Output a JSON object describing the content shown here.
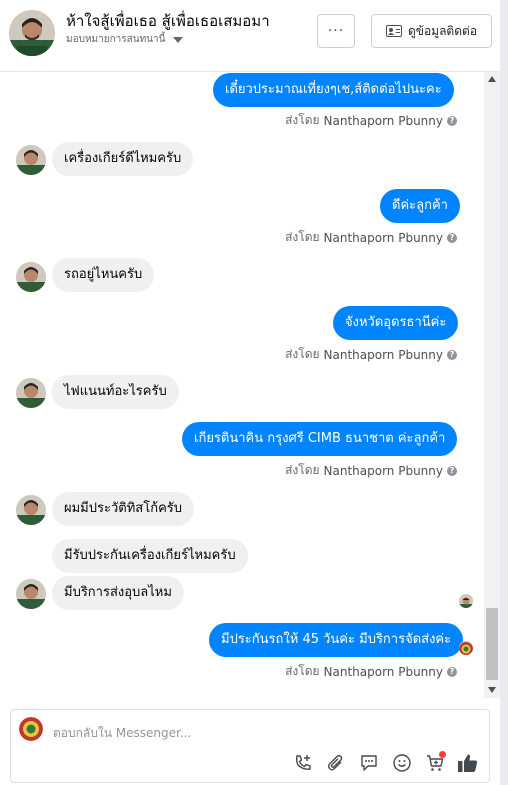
{
  "header": {
    "title": "ห้าใจสู้เพื่อเธอ สู้เพื่อเธอเสมอมา",
    "subtitle": "มอบหมายการสนทนานี้",
    "more_label": "···",
    "contact_label": "ดูข้อมูลติดต่อ"
  },
  "messages": {
    "m1": "เดี๋ยวประมาณเที่ยงๆเช,ส์ติดต่อไปนะคะ",
    "m2": "เครื่องเกียร์ดีไหมครับ",
    "m3": "ดีค่ะลูกค้า",
    "m4": "รถอยู่ไหนครับ",
    "m5": "จังหวัดอุดรธานีค่ะ",
    "m6": "ไฟแนนท์อะไรครับ",
    "m7": "เกียรตินาคิน กรุงศรี CIMB ธนาชาต ค่ะลูกค้า",
    "m8": "ผมมีประวัติทิสโก้ครับ",
    "m9": "มีรับประกันเครื่องเกียร์ไหมครับ",
    "m10": "มีบริการส่งอุบลไหม",
    "m11": "มีประกันรถให้ 45 วันค่ะ มีบริการจัดส่งค่ะ"
  },
  "sent_by": {
    "prefix": "ส่งโดย",
    "name": "Nanthaporn Pbunny",
    "help": "?"
  },
  "composer": {
    "placeholder": "ตอบกลับใน Messenger..."
  },
  "icons": {
    "more": "more-dots-icon",
    "contact": "contact-card-icon",
    "call": "add-call-icon",
    "attach": "paperclip-icon",
    "saved_reply": "saved-reply-icon",
    "emoji": "emoji-icon",
    "cart": "cart-icon",
    "like": "thumbs-up-icon"
  },
  "colors": {
    "outgoing_bubble": "#0084ff",
    "incoming_bubble": "#f1f0f0",
    "notification_dot": "#fa3e3e"
  }
}
